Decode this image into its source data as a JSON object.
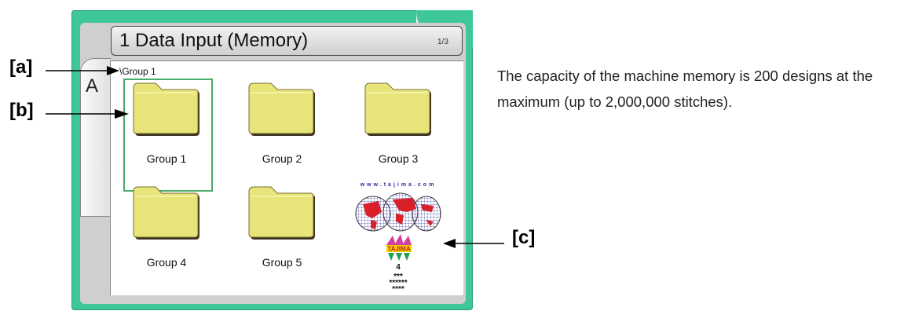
{
  "window": {
    "title": "1 Data Input (Memory)",
    "page_indicator": "1/3",
    "side_tab_label": "A",
    "path": "\\Group 1"
  },
  "folders": [
    {
      "label": "Group 1",
      "selected": true
    },
    {
      "label": "Group 2",
      "selected": false
    },
    {
      "label": "Group 3",
      "selected": false
    },
    {
      "label": "Group 4",
      "selected": false
    },
    {
      "label": "Group 5",
      "selected": false
    }
  ],
  "design_item": {
    "url_text": "www.tajima.com",
    "brand": "TAJIMA",
    "number": "4",
    "mask_line1": "***",
    "mask_line2": "******",
    "mask_line3": "****"
  },
  "callouts": {
    "a": "[a]",
    "b": "[b]",
    "c": "[c]"
  },
  "description": "The capacity of the machine memory is 200 designs at the maximum (up to 2,000,000 stitches).",
  "colors": {
    "frame": "#3ec89a",
    "folder": "#e7e57a",
    "selection": "#4aaa68"
  }
}
